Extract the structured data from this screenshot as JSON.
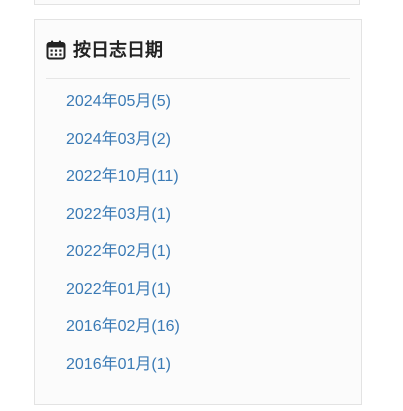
{
  "widget": {
    "title": "按日志日期",
    "icon": "calendar-icon",
    "accent_color": "#3a7ab5",
    "items": [
      {
        "label": "2024年05月(5)"
      },
      {
        "label": "2024年03月(2)"
      },
      {
        "label": "2022年10月(11)"
      },
      {
        "label": "2022年03月(1)"
      },
      {
        "label": "2022年02月(1)"
      },
      {
        "label": "2022年01月(1)"
      },
      {
        "label": "2016年02月(16)"
      },
      {
        "label": "2016年01月(1)"
      }
    ]
  }
}
